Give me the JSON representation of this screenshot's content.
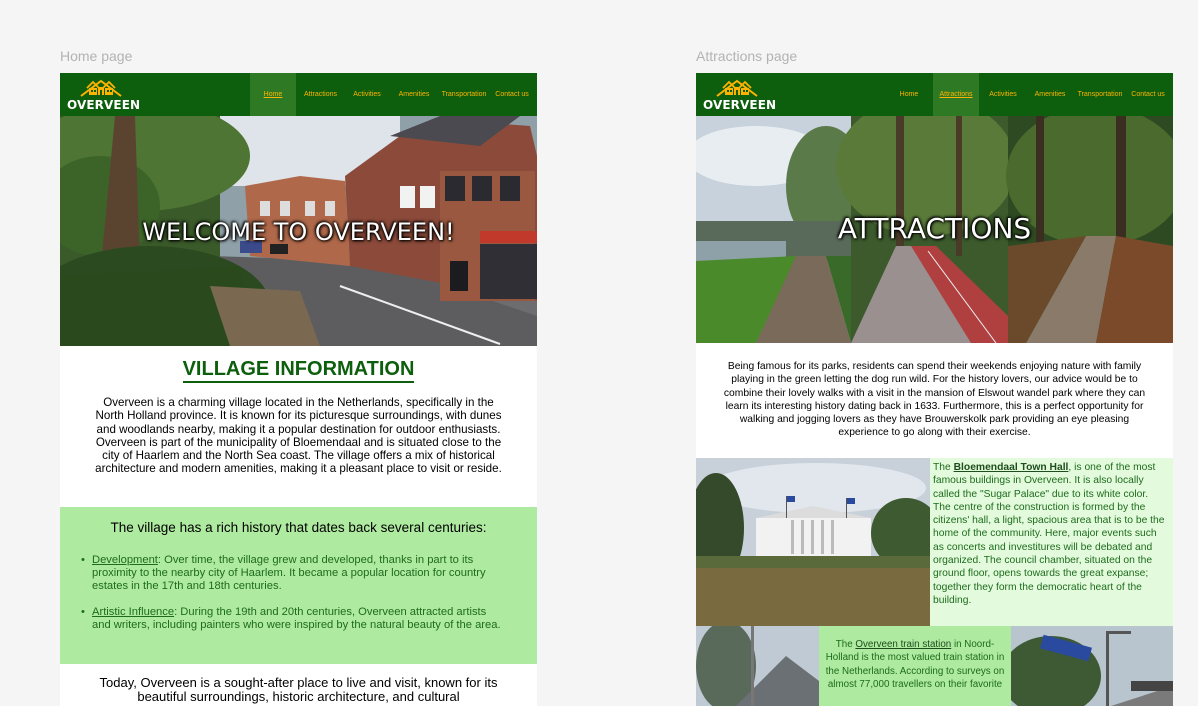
{
  "frames": {
    "home_label": "Home page",
    "attractions_label": "Attractions page"
  },
  "brand": {
    "name": "OVERVEEN",
    "green": "#0d5e0d",
    "accent": "#ffb300",
    "light_green": "#aeeaa0",
    "pale_green": "#e3fbdc"
  },
  "nav": {
    "items": [
      "Home",
      "Attractions",
      "Activities",
      "Amenities",
      "Transportation",
      "Contact us"
    ]
  },
  "home": {
    "active_nav": "Home",
    "hero_title": "WELCOME TO OVERVEEN!",
    "section_title": "VILLAGE INFORMATION",
    "intro": "Overveen is a charming village located in the Netherlands, specifically in the North Holland province. It is known for its picturesque surroundings, with dunes and woodlands nearby, making it a popular destination for outdoor enthusiasts. Overveen is part of the municipality of Bloemendaal and is situated close to the city of Haarlem and the North Sea coast. The village offers a mix of historical architecture and modern amenities, making it a pleasant place to visit or reside.",
    "history_heading": "The village has a rich history that dates back several centuries:",
    "bullets": [
      {
        "term": "Development",
        "text": ": Over time, the village grew and developed, thanks in part to its proximity to the nearby city of Haarlem. It became a popular location for country estates in the 17th and 18th centuries."
      },
      {
        "term": "Artistic Influence",
        "text": ": During the 19th and 20th centuries, Overveen attracted artists and writers, including painters who were inspired by the natural beauty of the area."
      }
    ],
    "today": "Today, Overveen is a sought-after place to live and visit, known for its beautiful surroundings, historic architecture, and cultural"
  },
  "attractions": {
    "active_nav": "Attractions",
    "hero_title": "ATTRACTIONS",
    "intro": "Being famous for its parks, residents can spend their weekends enjoying nature with family playing in the green letting the dog run wild. For the history lovers, our advice would be to combine their lovely walks with a visit in the mansion of Elswout wandel park where they can learn its interesting history dating back in 1633. Furthermore, this is a perfect opportunity for walking and jogging lovers as they have Brouwerskolk park providing an eye pleasing experience to go along with their exercise.",
    "town_hall": {
      "prefix": "The ",
      "link": "Bloemendaal Town Hall",
      "text": ", is one of the most famous buildings in Overveen. It is also locally called the \"Sugar Palace\" due to its white color.  The centre of the construction is formed by the citizens' hall, a light, spacious area that is to be the home of the community. Here, major events such as concerts and investitures will be debated and organized. The council chamber, situated on the ground floor, opens towards the great expanse; together they form the democratic heart of the building."
    },
    "train_station": {
      "prefix": "The ",
      "link": "Overveen train station",
      "text": " in Noord-Holland is the most valued train station in the Netherlands. According to surveys on almost 77,000 travellers on their favorite"
    }
  }
}
